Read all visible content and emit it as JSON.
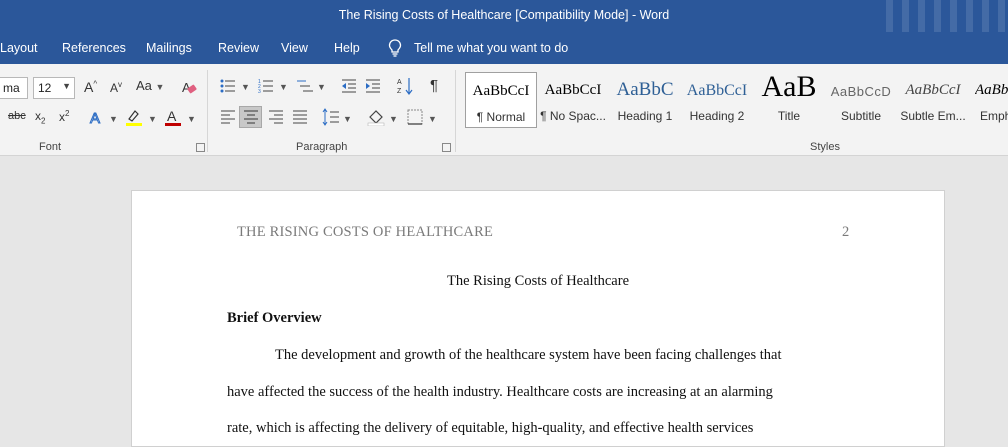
{
  "window": {
    "title": "The Rising Costs of Healthcare [Compatibility Mode]  -  Word"
  },
  "menu": {
    "items": [
      "Layout",
      "References",
      "Mailings",
      "Review",
      "View",
      "Help"
    ],
    "tell_me": "Tell me what you want to do"
  },
  "ribbon": {
    "font": {
      "font_name": "ma",
      "font_size": "12",
      "change_case": "Aa",
      "group_label": "Font"
    },
    "paragraph": {
      "group_label": "Paragraph"
    },
    "styles": {
      "group_label": "Styles",
      "items": [
        {
          "preview": "AaBbCcI",
          "name": "¶ Normal"
        },
        {
          "preview": "AaBbCcI",
          "name": "¶ No Spac..."
        },
        {
          "preview": "AaBbC",
          "name": "Heading 1"
        },
        {
          "preview": "AaBbCcI",
          "name": "Heading 2"
        },
        {
          "preview": "AaB",
          "name": "Title"
        },
        {
          "preview": "AaBbCcD",
          "name": "Subtitle"
        },
        {
          "preview": "AaBbCcI",
          "name": "Subtle Em..."
        },
        {
          "preview": "AaBb",
          "name": "Emph"
        }
      ]
    }
  },
  "document": {
    "running_head": "THE RISING COSTS OF HEALTHCARE",
    "page_number": "2",
    "title": "The Rising Costs of Healthcare",
    "heading": "Brief Overview",
    "lines": [
      "The development and growth of the healthcare system have been facing challenges that",
      "have affected the success of the health industry. Healthcare costs are increasing at an alarming",
      "rate, which is affecting the delivery of equitable, high-quality, and effective health services"
    ]
  },
  "colors": {
    "title_bar": "#2b579a",
    "ribbon_bg": "#f3f3f3",
    "canvas_bg": "#e6e6e6",
    "font_color_underline": "#c00000",
    "highlight_underline": "#ffff00"
  }
}
